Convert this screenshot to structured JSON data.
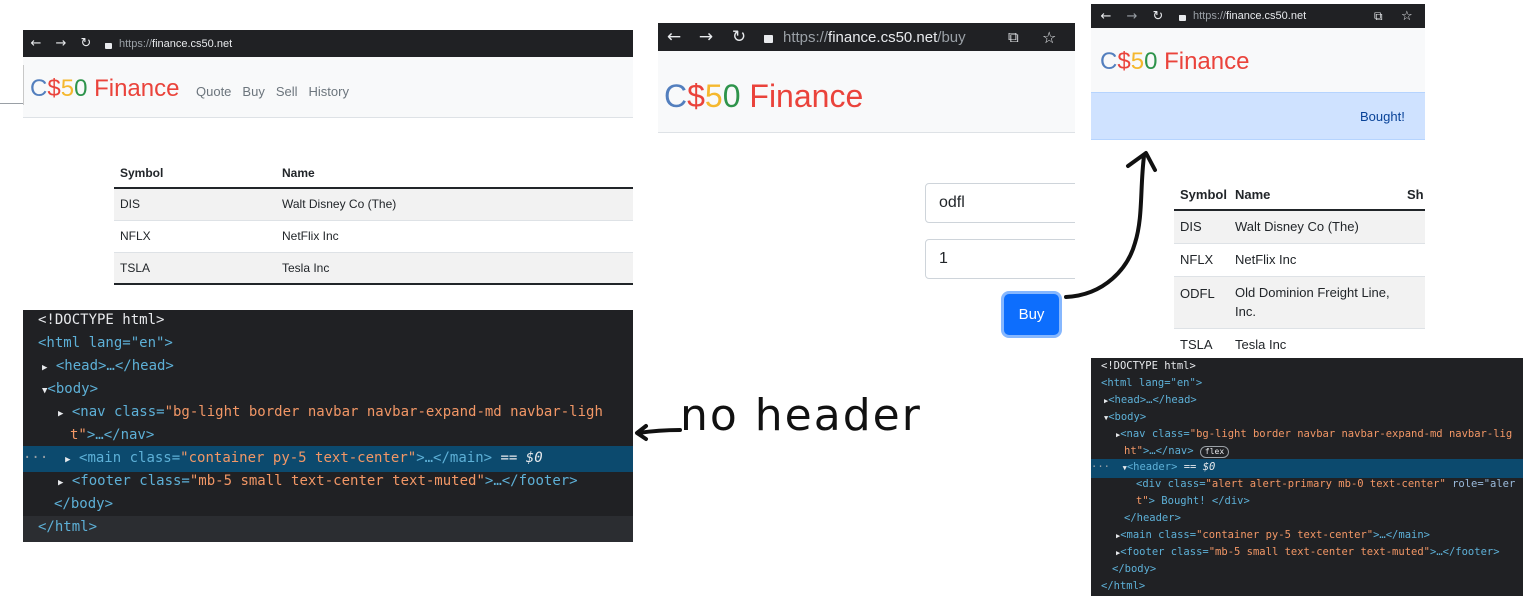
{
  "left": {
    "url_scheme": "https://",
    "url_host": "finance.cs50.net",
    "url_path": "",
    "brand": {
      "c": "C",
      "dollar": "$",
      "five": "5",
      "zero": "0",
      "rest": "Finance"
    },
    "nav": [
      "Quote",
      "Buy",
      "Sell",
      "History"
    ],
    "table": {
      "headers": [
        "Symbol",
        "Name"
      ],
      "rows": [
        [
          "DIS",
          "Walt Disney Co (The)"
        ],
        [
          "NFLX",
          "NetFlix Inc"
        ],
        [
          "TSLA",
          "Tesla Inc"
        ]
      ]
    },
    "devtools": {
      "doctype": "<!DOCTYPE html>",
      "html_open": "<html lang=\"en\">",
      "head": "<head>…</head>",
      "body_open": "<body>",
      "nav_tag": "<nav class=",
      "nav_class": "\"bg-light border navbar navbar-expand-md navbar-ligh",
      "nav_cont": "t\"",
      "nav_end": ">…</nav>",
      "main_tag": "<main class=",
      "main_class": "\"container py-5 text-center\"",
      "main_end": ">…</main>",
      "main_suffix": " == $0",
      "footer_tag": "<footer class=",
      "footer_class": "\"mb-5 small text-center text-muted\"",
      "footer_end": ">…</footer>",
      "body_close": "</body>",
      "html_close": "</html>"
    }
  },
  "annotation": "no header",
  "middle": {
    "url_scheme": "https://",
    "url_host": "finance.cs50.net",
    "url_path": "/buy",
    "brand": {
      "c": "C",
      "dollar": "$",
      "five": "5",
      "zero": "0",
      "rest": "Finance"
    },
    "symbol_value": "odfl",
    "shares_value": "1",
    "buy_label": "Buy"
  },
  "right": {
    "url_scheme": "https://",
    "url_host": "finance.cs50.net",
    "brand": {
      "c": "C",
      "dollar": "$",
      "five": "5",
      "zero": "0",
      "rest": "Finance"
    },
    "alert": "Bought!",
    "table": {
      "headers": [
        "Symbol",
        "Name",
        "Sh"
      ],
      "rows": [
        [
          "DIS",
          "Walt Disney Co (The)"
        ],
        [
          "NFLX",
          "NetFlix Inc"
        ],
        [
          "ODFL",
          "Old Dominion Freight Line, Inc."
        ],
        [
          "TSLA",
          "Tesla Inc"
        ]
      ]
    },
    "devtools": {
      "doctype": "<!DOCTYPE html>",
      "html_open": "<html lang=\"en\">",
      "head": "<head>…</head>",
      "body_open": "<body>",
      "nav_tag": "<nav class=",
      "nav_class": "\"bg-light border navbar navbar-expand-md navbar-lig",
      "nav_cont": "ht\"",
      "nav_end": ">…</nav>",
      "flex": "flex",
      "header_open": "<header>",
      "header_suffix": " == $0",
      "div_tag": "<div class=",
      "div_class": "\"alert alert-primary mb-0 text-center\"",
      "div_role": " role=\"aler",
      "div_cont": "t\"",
      "div_text": "> Bought! </div>",
      "header_close": "</header>",
      "main_tag": "<main class=",
      "main_class": "\"container py-5 text-center\"",
      "main_end": ">…</main>",
      "footer_tag": "<footer class=",
      "footer_class": "\"mb-5 small text-center text-muted\"",
      "footer_end": ">…</footer>",
      "body_close": "</body>",
      "html_close": "</html>"
    }
  },
  "colors": {
    "brand_blue": "#537fbe",
    "brand_red": "#ea433b",
    "brand_yellow": "#f5b82e",
    "brand_green": "#2e944b",
    "alert_bg": "#cfe2ff",
    "button": "#0d6efd"
  }
}
